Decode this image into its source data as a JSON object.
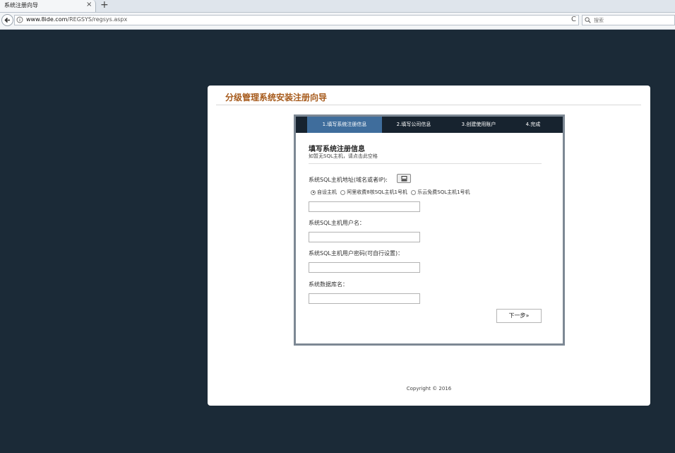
{
  "browser": {
    "tab_title": "系统注册向导",
    "tab_close": "×",
    "new_tab": "+",
    "url_domain": "www.8ide.com",
    "url_path": "/REGSYS/regsys.aspx",
    "reload": "C",
    "search_placeholder": "搜索"
  },
  "page": {
    "title": "分级管理系统安装注册向导",
    "steps": [
      {
        "label": "1.填写系统注册信息",
        "active": true
      },
      {
        "label": "2.填写公司信息",
        "active": false
      },
      {
        "label": "3.创建使用账户",
        "active": false
      },
      {
        "label": "4.完成",
        "active": false
      }
    ],
    "section_title": "填写系统注册信息",
    "section_subtitle": "如暂无SQL主机，请点击此空格",
    "host_label": "系统SQL主机地址(域名或者IP):",
    "radios": [
      {
        "label": "自设主机",
        "checked": true
      },
      {
        "label": "阿里收费8核SQL主机1号机",
        "checked": false
      },
      {
        "label": "乐云免费SQL主机1号机",
        "checked": false
      }
    ],
    "host_value": "",
    "user_label": "系统SQL主机用户名：",
    "user_value": "",
    "password_label": "系统SQL主机用户密码(可自行设置)：",
    "password_value": "",
    "dbname_label": "系统数据库名：",
    "dbname_value": "",
    "next_button": "下一步»",
    "copyright": "Copyright © 2016"
  },
  "colors": {
    "background": "#1b2a37",
    "title": "#a65a1b",
    "steps_bar": "#17232f",
    "active_step": "#3f6d9c"
  }
}
